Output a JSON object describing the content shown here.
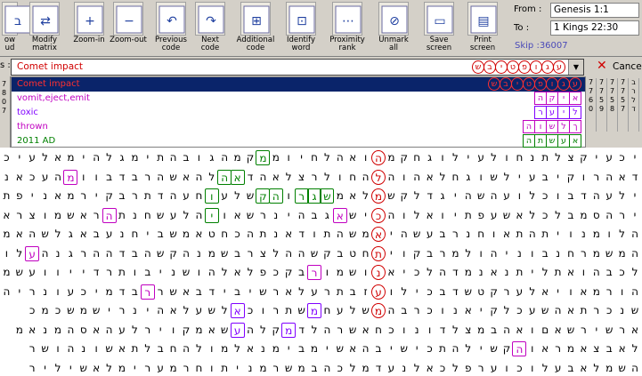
{
  "toolbar": {
    "buttons": [
      {
        "label": "ow\nud",
        "icon": "book-icon"
      },
      {
        "label": "Modify\nmatrix",
        "icon": "modify-matrix-icon"
      },
      {
        "label": "Zoom-in",
        "icon": "zoom-in-icon"
      },
      {
        "label": "Zoom-out",
        "icon": "zoom-out-icon"
      },
      {
        "label": "Previous\ncode",
        "icon": "previous-code-icon"
      },
      {
        "label": "Next\ncode",
        "icon": "next-code-icon"
      },
      {
        "label": "Additional\ncode",
        "icon": "additional-code-icon"
      },
      {
        "label": "Identify\nword",
        "icon": "identify-word-icon"
      },
      {
        "label": "Proximity\nrank",
        "icon": "proximity-rank-icon"
      },
      {
        "label": "Unmark\nall",
        "icon": "unmark-all-icon"
      },
      {
        "label": "Save\nscreen",
        "icon": "save-screen-icon"
      },
      {
        "label": "Print\nscreen",
        "icon": "print-screen-icon"
      }
    ],
    "from_label": "From :",
    "from_value": "Genesis 1:1",
    "to_label": "To :",
    "to_value": "1 Kings 22:30",
    "skip": "Skip :36007"
  },
  "search": {
    "prefix": "s :",
    "value": "Comet impact",
    "hebrew": "שביטפוגע",
    "cancel_label": "Cance"
  },
  "wordlist": [
    {
      "text": "Comet impact",
      "hebrew": "שביטפוגע",
      "color": "#ff3030",
      "selected": true,
      "shape": "circle"
    },
    {
      "text": "vomit,eject,emit",
      "hebrew": "הקיא",
      "color": "#c000c0",
      "selected": false,
      "shape": "square"
    },
    {
      "text": "toxic",
      "hebrew": "רעיל",
      "color": "#8000ff",
      "selected": false,
      "shape": "square"
    },
    {
      "text": "thrown",
      "hebrew": "הושלך",
      "color": "#c000c0",
      "selected": false,
      "shape": "square"
    },
    {
      "text": "2011 AD",
      "hebrew": "התשעא",
      "color": "#008000",
      "selected": false,
      "shape": "square"
    }
  ],
  "left_col": [
    "7",
    "8",
    "0",
    "7"
  ],
  "right_cols": [
    [
      "7",
      "7",
      "6",
      "0"
    ],
    [
      "7",
      "7",
      "5",
      "9"
    ],
    [
      "7",
      "7",
      "5",
      "8"
    ],
    [
      "7",
      "7",
      "5",
      "7"
    ],
    [
      "ב",
      "ר",
      "ל",
      "ד"
    ]
  ],
  "grid_rows": [
    "יכעיקצלתנחולעילוגחקמהואהלחיוממקמהגובהתימגלהימאלעיכסמכ",
    "דאהרוקיבעילשוגחלאהוהלהחולרצלאהדאהלהאשהרבדבוומהעכאנכת",
    "ילעהדבוכלועהשהיגדלקשמלאמשגרוהקשלעוחעהדתרבקירמאניפתחנ",
    "ירהסמבלכלאשעפתיואלוהכישאגבהינרשאויהלעשחנתהראשמוצראתמ",
    "הלומנויתהתאוחנרבעשהיאמשהתודאנתהכחטאמשביחנעבאגלשהאמש",
    "המשמרחנבוניהולמרבקויתחטבקשההלצרבשמנהקשהבדההרגנהעלות",
    "לכבהואתליתנאנמדהלכיאנושמורבקכפלאלהושניבותרדייוועשמ",
    "הורמאויאלערקטשדבכילועזבתרעלארשיבידבאשררבדמיכעונריהל",
    "שנכרתאהשעכלקיאנוכרבהמשלעחמשתרוכאלשעלאהינרישמשכמכ",
    "ארשירשאםואהבמצלדונוכחאשרהלדמקלהעשאמקוירלעהאסהמנאמ",
    "לאבצאמראוהקשילהתכישיבהאשימבימנאלמולהחבלתאשונהושר",
    "השמלאבעלוכוערפלכאלנעדמלכהבמשרמניתוחרמערימלאשיליר"
  ],
  "marks": [
    {
      "r": 0,
      "c": 20,
      "col": "#d00000",
      "circle": true
    },
    {
      "r": 0,
      "c": 29,
      "col": "#008000"
    },
    {
      "r": 1,
      "c": 20,
      "col": "#d00000",
      "circle": true
    },
    {
      "r": 1,
      "c": 31,
      "col": "#008000"
    },
    {
      "r": 1,
      "c": 32,
      "col": "#008000"
    },
    {
      "r": 1,
      "c": 44,
      "col": "#c000c0"
    },
    {
      "r": 2,
      "c": 20,
      "col": "#d00000",
      "circle": true
    },
    {
      "r": 2,
      "c": 24,
      "col": "#008000"
    },
    {
      "r": 2,
      "c": 25,
      "col": "#008000"
    },
    {
      "r": 2,
      "c": 26,
      "col": "#008000"
    },
    {
      "r": 2,
      "c": 28,
      "col": "#008000"
    },
    {
      "r": 2,
      "c": 29,
      "col": "#008000"
    },
    {
      "r": 2,
      "c": 33,
      "col": "#008000"
    },
    {
      "r": 3,
      "c": 20,
      "col": "#d00000",
      "circle": true
    },
    {
      "r": 3,
      "c": 23,
      "col": "#c000c0"
    },
    {
      "r": 3,
      "c": 33,
      "col": "#008000"
    },
    {
      "r": 3,
      "c": 41,
      "col": "#c000c0"
    },
    {
      "r": 4,
      "c": 20,
      "col": "#d00000",
      "circle": true
    },
    {
      "r": 5,
      "c": 20,
      "col": "#d00000",
      "circle": true
    },
    {
      "r": 5,
      "c": 47,
      "col": "#c000c0"
    },
    {
      "r": 6,
      "c": 20,
      "col": "#d00000",
      "circle": true
    },
    {
      "r": 6,
      "c": 25,
      "col": "#c000c0"
    },
    {
      "r": 7,
      "c": 20,
      "col": "#d00000",
      "circle": true
    },
    {
      "r": 7,
      "c": 38,
      "col": "#c000c0"
    },
    {
      "r": 8,
      "c": 20,
      "col": "#d00000",
      "circle": true
    },
    {
      "r": 8,
      "c": 25,
      "col": "#8000ff"
    },
    {
      "r": 8,
      "c": 31,
      "col": "#8000ff"
    },
    {
      "r": 9,
      "c": 27,
      "col": "#8000ff"
    },
    {
      "r": 9,
      "c": 31,
      "col": "#8000ff"
    },
    {
      "r": 10,
      "c": 9,
      "col": "#c000c0"
    }
  ]
}
